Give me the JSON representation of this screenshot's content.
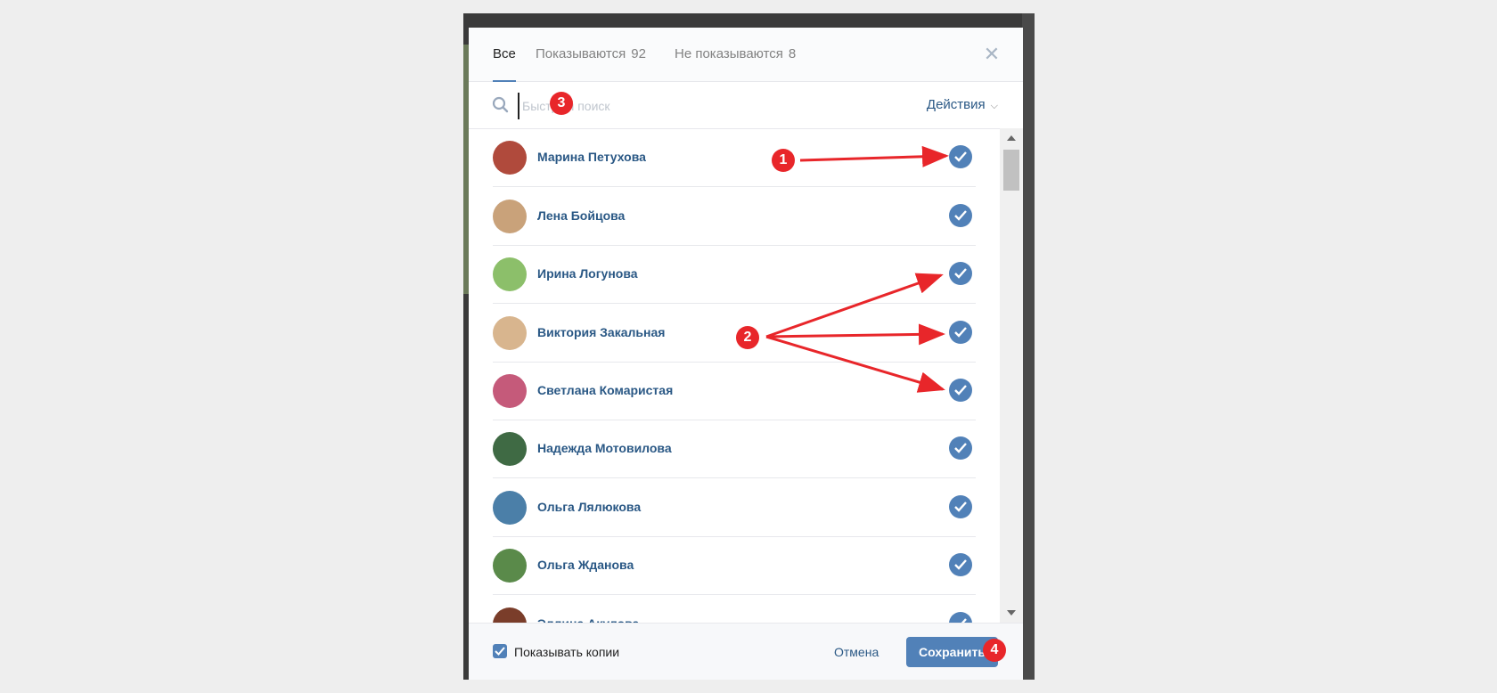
{
  "tabs": [
    {
      "label": "Все",
      "count": ""
    },
    {
      "label": "Показываются",
      "count": "92"
    },
    {
      "label": "Не показываются",
      "count": "8"
    }
  ],
  "search": {
    "placeholder": "Быстрый поиск",
    "value": ""
  },
  "actions_label": "Действия",
  "friends": [
    {
      "name": "Марина Петухова",
      "checked": true,
      "avatar_color": "#b04a3c"
    },
    {
      "name": "Лена Бойцова",
      "checked": true,
      "avatar_color": "#c9a27a"
    },
    {
      "name": "Ирина Логунова",
      "checked": true,
      "avatar_color": "#8cbf6a"
    },
    {
      "name": "Виктория Закальная",
      "checked": true,
      "avatar_color": "#d8b58e"
    },
    {
      "name": "Светлана Комаристая",
      "checked": true,
      "avatar_color": "#c55a7a"
    },
    {
      "name": "Надежда Мотовилова",
      "checked": true,
      "avatar_color": "#3f6a44"
    },
    {
      "name": "Ольга Лялюкова",
      "checked": true,
      "avatar_color": "#4b7fa8"
    },
    {
      "name": "Ольга Жданова",
      "checked": true,
      "avatar_color": "#5a8a4a"
    },
    {
      "name": "Эллина Акулова",
      "checked": true,
      "avatar_color": "#7a3d2a"
    }
  ],
  "footer": {
    "show_copies_label": "Показывать копии",
    "show_copies_checked": true,
    "cancel_label": "Отмена",
    "save_label": "Сохранить"
  },
  "annotations": [
    "1",
    "2",
    "3",
    "4"
  ],
  "colors": {
    "accent": "#5181b8",
    "link": "#2a5885",
    "annotation": "#e8262a"
  }
}
